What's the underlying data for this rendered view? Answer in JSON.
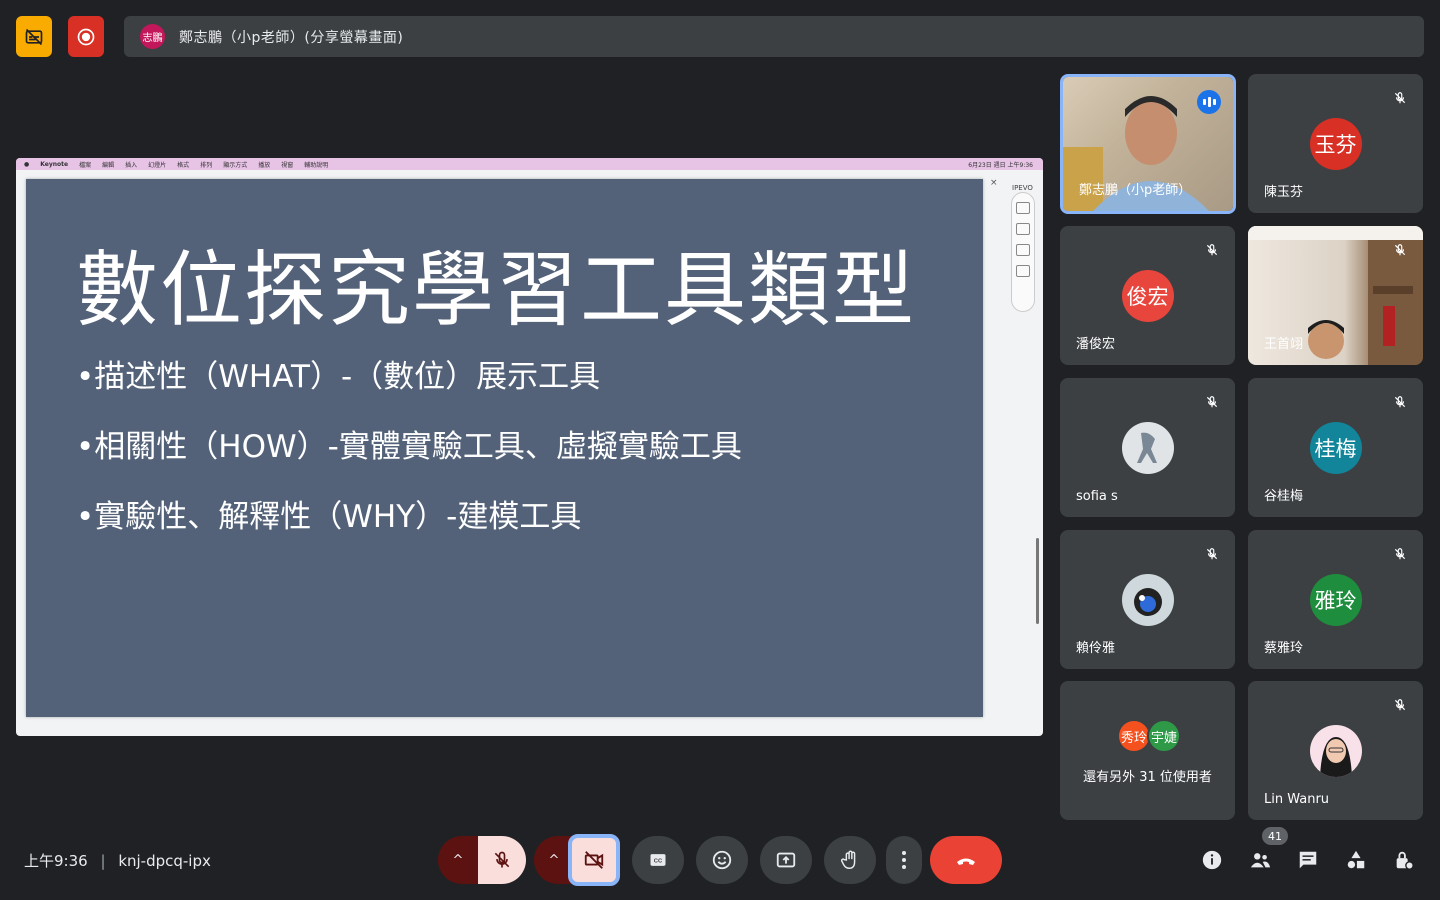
{
  "presenter_bar": {
    "avatar_text": "志鵬",
    "text": "鄭志鵬（小p老師）(分享螢幕畫面)"
  },
  "shared_screen": {
    "menubar": {
      "app": "Keynote",
      "items": [
        "檔案",
        "編輯",
        "插入",
        "幻燈片",
        "格式",
        "排列",
        "顯示方式",
        "播放",
        "視窗",
        "輔助說明"
      ],
      "clock": "6月23日 週日 上午9:36"
    },
    "slide": {
      "title": "數位探究學習工具類型",
      "bullets": [
        "•描述性（WHAT）-（數位）展示工具",
        "•相關性（HOW）-實體實驗工具、虛擬實驗工具",
        "•實驗性、解釋性（WHY）-建模工具"
      ]
    },
    "side_label": "IPEVO"
  },
  "participants": [
    {
      "name": "鄭志鵬（小p老師）",
      "type": "video",
      "speaking": true
    },
    {
      "name": "陳玉芬",
      "avatar_text": "玉芬",
      "avatar_color": "#d93025",
      "muted": true
    },
    {
      "name": "潘俊宏",
      "avatar_text": "俊宏",
      "avatar_color": "#e8453c",
      "muted": true
    },
    {
      "name": "王首翊",
      "type": "video",
      "muted": true
    },
    {
      "name": "sofia s",
      "avatar_text": "",
      "avatar_color": "#cfd8dc",
      "muted": true
    },
    {
      "name": "谷桂梅",
      "avatar_text": "桂梅",
      "avatar_color": "#12859b",
      "muted": true
    },
    {
      "name": "賴伶雅",
      "avatar_text": "",
      "avatar_color": "#455a64",
      "muted": true
    },
    {
      "name": "蔡雅玲",
      "avatar_text": "雅玲",
      "avatar_color": "#1e8e3e",
      "muted": true
    },
    {
      "name": "Lin Wanru",
      "avatar_text": "",
      "avatar_color": "#f8bbd0",
      "muted": true
    }
  ],
  "more_tile": {
    "avatars": [
      {
        "text": "秀玲",
        "color": "#f4511e"
      },
      {
        "text": "宇婕",
        "color": "#2e9a47"
      }
    ],
    "text": "還有另外 31 位使用者"
  },
  "bottom_bar": {
    "time": "上午9:36",
    "separator": "|",
    "meeting_code": "knj-dpcq-ipx",
    "participant_count": "41"
  },
  "icons": {
    "no_subtitles": "subtitles-off-icon",
    "record": "record-icon",
    "mic": "mic-off-icon",
    "cam": "videocam-off-icon",
    "captions": "closed-caption-icon",
    "emoji": "emoji-icon",
    "present": "present-screen-icon",
    "hand": "raise-hand-icon",
    "more": "more-vert-icon",
    "end": "call-end-icon",
    "info": "info-icon",
    "people": "people-icon",
    "chat": "chat-icon",
    "activities": "activities-icon",
    "host": "host-controls-icon"
  },
  "colors": {
    "background": "#202124",
    "tile": "#3c4043",
    "end_call": "#ea4335",
    "accent": "#8ab4f8"
  }
}
